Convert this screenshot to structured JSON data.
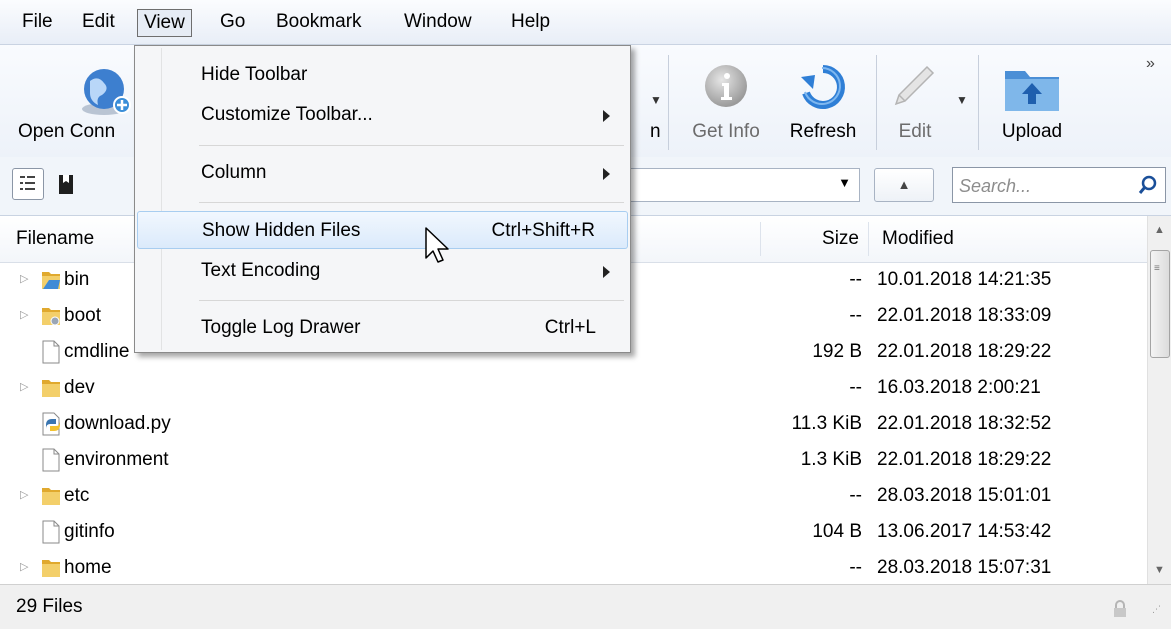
{
  "menubar": {
    "items": [
      {
        "label": "File"
      },
      {
        "label": "Edit"
      },
      {
        "label": "View",
        "active": true
      },
      {
        "label": "Go"
      },
      {
        "label": "Bookmark"
      },
      {
        "label": "Window"
      },
      {
        "label": "Help"
      }
    ]
  },
  "toolbar": {
    "open_connection": "Open Conn",
    "get_info": "Get Info",
    "refresh": "Refresh",
    "edit": "Edit",
    "upload": "Upload",
    "partial_label": "n"
  },
  "search": {
    "placeholder": "Search..."
  },
  "columns": {
    "filename": "Filename",
    "size": "Size",
    "modified": "Modified"
  },
  "files": [
    {
      "name": "bin",
      "type": "folder",
      "size": "--",
      "modified": "10.01.2018 14:21:35"
    },
    {
      "name": "boot",
      "type": "folder",
      "size": "--",
      "modified": "22.01.2018 18:33:09"
    },
    {
      "name": "cmdline",
      "type": "file",
      "size": "192 B",
      "modified": "22.01.2018 18:29:22"
    },
    {
      "name": "dev",
      "type": "folder",
      "size": "--",
      "modified": "16.03.2018 2:00:21"
    },
    {
      "name": "download.py",
      "type": "python",
      "size": "11.3 KiB",
      "modified": "22.01.2018 18:32:52"
    },
    {
      "name": "environment",
      "type": "file",
      "size": "1.3 KiB",
      "modified": "22.01.2018 18:29:22"
    },
    {
      "name": "etc",
      "type": "folder",
      "size": "--",
      "modified": "28.03.2018 15:01:01"
    },
    {
      "name": "gitinfo",
      "type": "file",
      "size": "104 B",
      "modified": "13.06.2017 14:53:42"
    },
    {
      "name": "home",
      "type": "folder",
      "size": "--",
      "modified": "28.03.2018 15:07:31"
    }
  ],
  "view_menu": {
    "hide_toolbar": "Hide Toolbar",
    "customize_toolbar": "Customize Toolbar...",
    "column": "Column",
    "show_hidden_files": "Show Hidden Files",
    "show_hidden_files_shortcut": "Ctrl+Shift+R",
    "text_encoding": "Text Encoding",
    "toggle_log_drawer": "Toggle Log Drawer",
    "toggle_log_drawer_shortcut": "Ctrl+L"
  },
  "status": {
    "text": "29 Files"
  },
  "colors": {
    "menu_highlight": "#dbeafb",
    "folder": "#e8b93b",
    "toolbar_bg": "#edf2f9"
  }
}
